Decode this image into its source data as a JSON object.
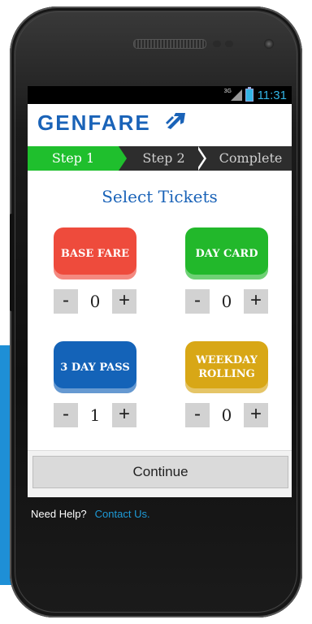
{
  "status_bar": {
    "network_label": "3G",
    "time": "11:31"
  },
  "header": {
    "logo_text": "GENFARE"
  },
  "steps": {
    "step1": "Step 1",
    "step2": "Step 2",
    "step3": "Complete"
  },
  "main": {
    "title": "Select Tickets",
    "tickets": [
      {
        "name_line1": "BASE FARE",
        "name_line2": "",
        "quantity": "0",
        "color": "#ee4b3c"
      },
      {
        "name_line1": "DAY CARD",
        "name_line2": "",
        "quantity": "0",
        "color": "#22b82b"
      },
      {
        "name_line1": "3 DAY PASS",
        "name_line2": "",
        "quantity": "1",
        "color": "#1463b8"
      },
      {
        "name_line1": "WEEKDAY",
        "name_line2": "ROLLING",
        "quantity": "0",
        "color": "#d8a716"
      }
    ],
    "minus_label": "-",
    "plus_label": "+",
    "continue_label": "Continue"
  },
  "footer": {
    "help_text": "Need Help?",
    "contact_link": "Contact Us."
  }
}
